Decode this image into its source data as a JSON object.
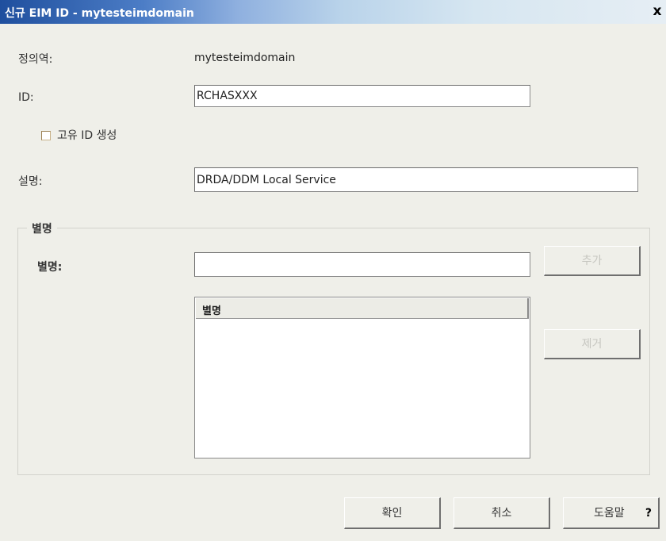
{
  "window": {
    "title": "신규 EIM ID - mytesteimdomain",
    "close_glyph": "x"
  },
  "form": {
    "domain_label": "정의역:",
    "domain_value": "mytesteimdomain",
    "id_label": "ID:",
    "id_value": "RCHASXXX",
    "unique_label": "고유 ID 생성",
    "unique_checked": false,
    "desc_label": "설명:",
    "desc_value": "DRDA/DDM Local Service"
  },
  "alias_group": {
    "title": "별명",
    "alias_label": "별명:",
    "alias_value": "",
    "add_label": "추가",
    "list_header": "별명",
    "items": [],
    "remove_label": "제거"
  },
  "buttons": {
    "ok": "확인",
    "cancel": "취소",
    "help": "도움말",
    "help_q": "?"
  }
}
